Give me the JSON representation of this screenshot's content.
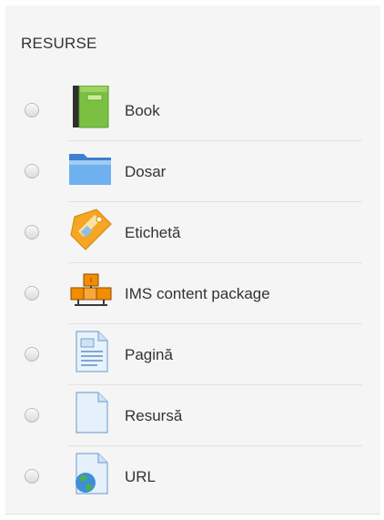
{
  "section": {
    "title": "RESURSE"
  },
  "items": [
    {
      "label": "Book",
      "icon": "book-icon"
    },
    {
      "label": "Dosar",
      "icon": "folder-icon"
    },
    {
      "label": "Etichetă",
      "icon": "label-tag-icon"
    },
    {
      "label": "IMS content package",
      "icon": "ims-package-icon"
    },
    {
      "label": "Pagină",
      "icon": "page-icon"
    },
    {
      "label": "Resursă",
      "icon": "file-resource-icon"
    },
    {
      "label": "URL",
      "icon": "url-globe-icon"
    }
  ],
  "colors": {
    "panel_background": "#f5f5f5",
    "text": "#333333",
    "book_green": "#7ac143",
    "folder_blue": "#5aa0e6",
    "tag_orange": "#f5a623",
    "package_orange": "#f28c00",
    "page_blue": "#cfe3f7"
  }
}
